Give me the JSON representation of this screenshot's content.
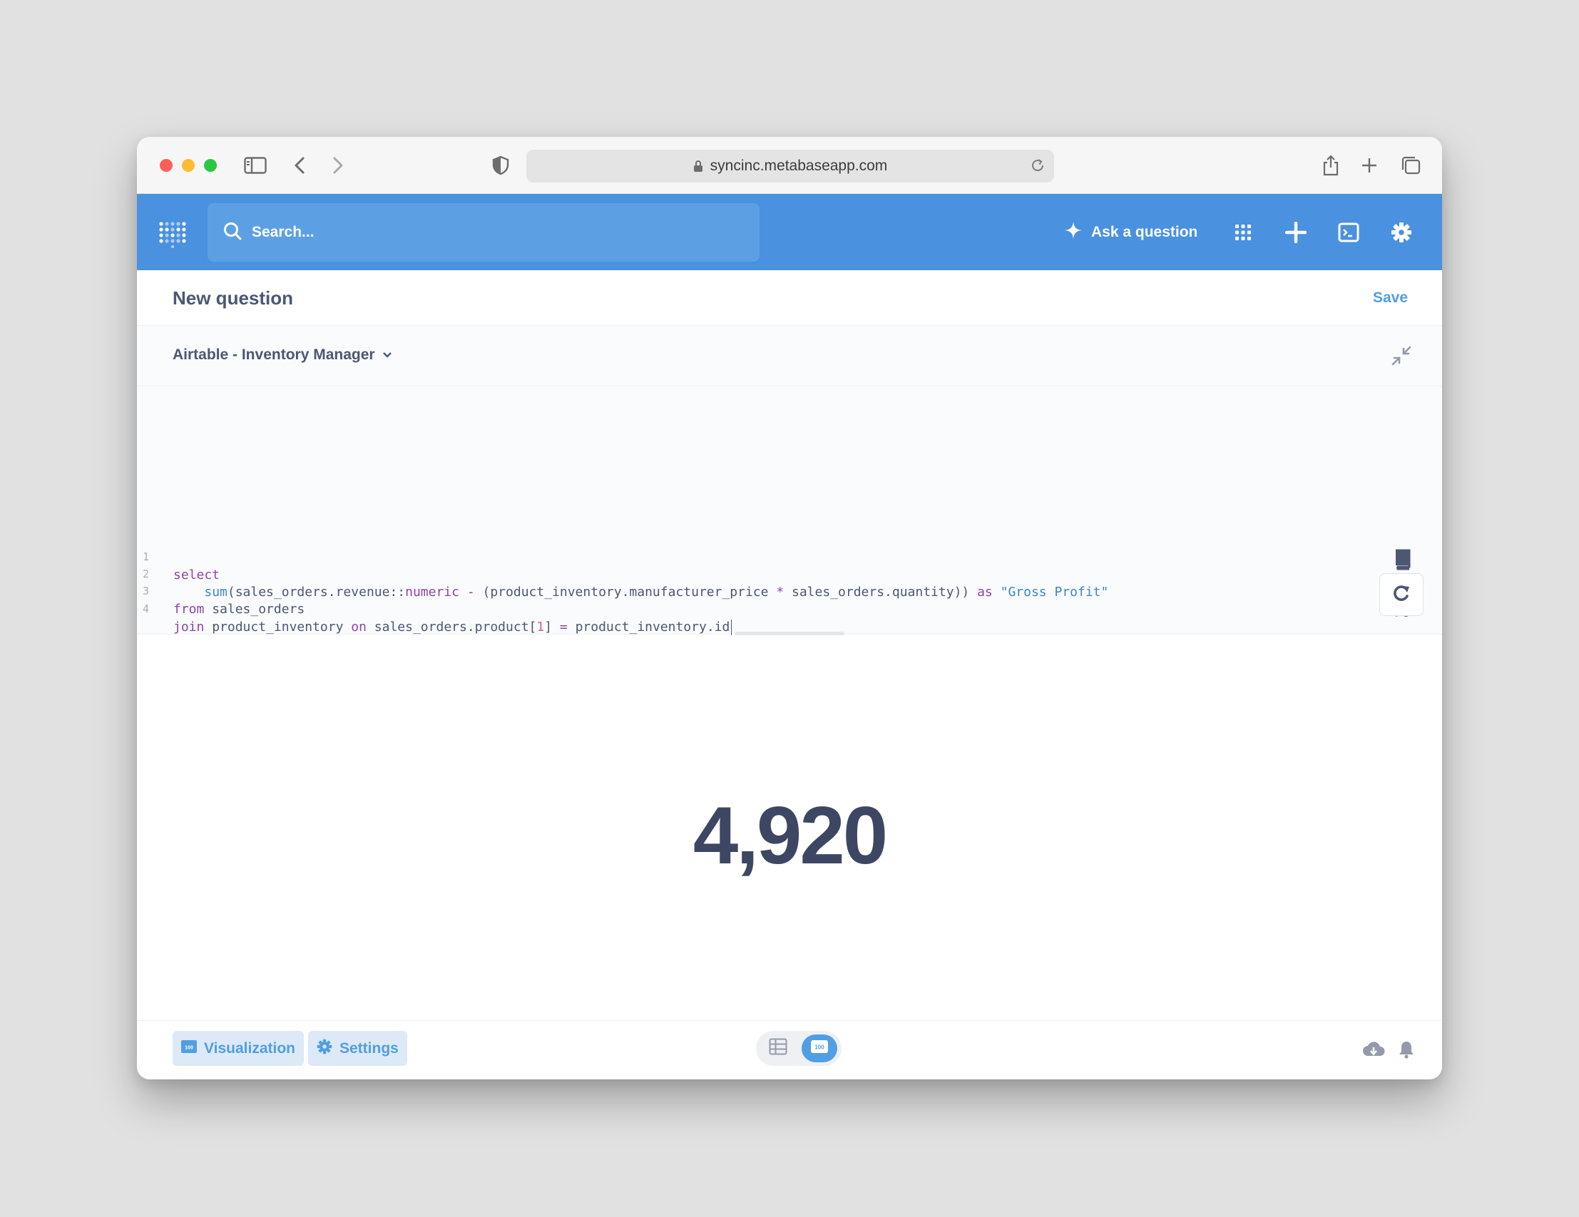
{
  "browser": {
    "url": "syncinc.metabaseapp.com"
  },
  "nav": {
    "search_placeholder": "Search...",
    "ask_label": "Ask a question",
    "bg_color": "#4a91df"
  },
  "question": {
    "title": "New question",
    "save_label": "Save"
  },
  "database": {
    "name": "Airtable - Inventory Manager"
  },
  "editor": {
    "lines": [
      {
        "number": "1",
        "text": "select"
      },
      {
        "number": "2",
        "text": "    sum(sales_orders.revenue::numeric - (product_inventory.manufacturer_price * sales_orders.quantity)) as \"Gross Profit\""
      },
      {
        "number": "3",
        "text": "from sales_orders"
      },
      {
        "number": "4",
        "text": "join product_inventory on sales_orders.product[1] = product_inventory.id"
      }
    ]
  },
  "result": {
    "value": "4,920"
  },
  "footer": {
    "visualization_label": "Visualization",
    "settings_label": "Settings",
    "badge_text": "100"
  },
  "icons": {
    "browser": [
      "sidebar-icon",
      "back-icon",
      "forward-icon",
      "shield-icon",
      "lock-icon",
      "reload-icon",
      "share-icon",
      "new-tab-icon",
      "tabs-icon"
    ],
    "nav": [
      "metabase-logo",
      "search-icon",
      "sparkle-icon",
      "apps-grid-icon",
      "plus-icon",
      "terminal-icon",
      "gear-icon"
    ],
    "editor": [
      "collapse-icon",
      "book-icon",
      "variable-icon",
      "snippet-icon",
      "refresh-icon"
    ],
    "footer": [
      "table-icon",
      "number-icon",
      "download-icon",
      "bell-icon"
    ]
  }
}
